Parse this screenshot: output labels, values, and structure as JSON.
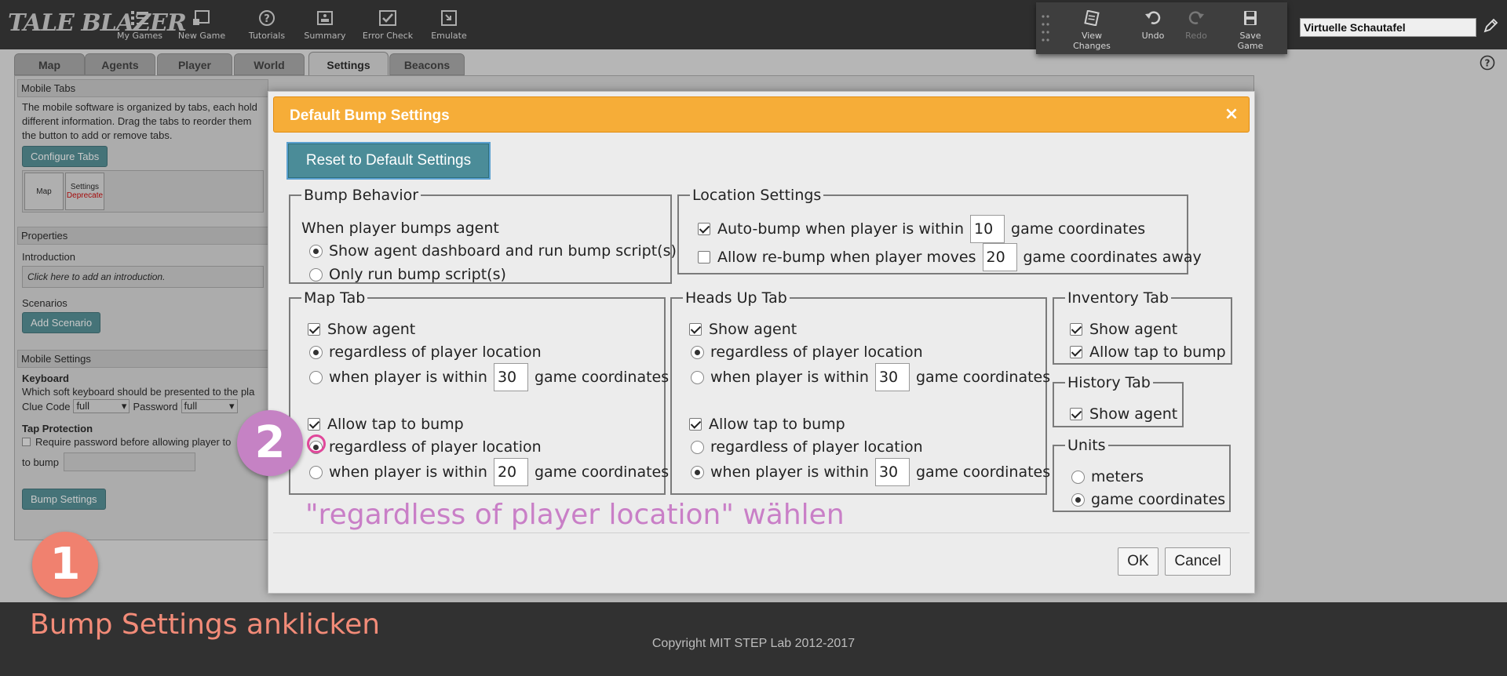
{
  "app": {
    "logo_text": "TALE BLAZER",
    "nav": [
      {
        "label": "My Games",
        "icon": "list-icon"
      },
      {
        "label": "New Game",
        "icon": "new-game-icon"
      },
      {
        "label": "Tutorials",
        "icon": "question-icon"
      },
      {
        "label": "Summary",
        "icon": "summary-icon"
      },
      {
        "label": "Error Check",
        "icon": "check-icon"
      },
      {
        "label": "Emulate",
        "icon": "emulate-icon"
      }
    ],
    "toolbar": {
      "view_changes": "View Changes",
      "undo": "Undo",
      "redo": "Redo",
      "save_game": "Save Game"
    },
    "game_title": "Virtuelle Schautafel"
  },
  "tabs": [
    "Map",
    "Agents",
    "Player",
    "World",
    "Settings",
    "Beacons"
  ],
  "active_tab": "Settings",
  "left_panel": {
    "mobile_tabs_header": "Mobile Tabs",
    "mobile_tabs_desc_1": "The mobile software is organized by tabs, each hold",
    "mobile_tabs_desc_2": "different information. Drag the tabs to reorder them",
    "mobile_tabs_desc_3": "the button to add or remove tabs.",
    "configure_tabs": "Configure Tabs",
    "mini_tab_map": "Map",
    "mini_tab_settings": "Settings",
    "mini_tab_deprecated": "Deprecate",
    "properties_header": "Properties",
    "introduction_label": "Introduction",
    "introduction_placeholder": "Click here to add an introduction.",
    "scenarios_label": "Scenarios",
    "add_scenario": "Add Scenario",
    "mobile_settings_header": "Mobile Settings",
    "keyboard_label": "Keyboard",
    "keyboard_desc": "Which soft keyboard should be presented to the pla",
    "clue_code_label": "Clue Code",
    "clue_code_value": "full",
    "password_label": "Password",
    "password_value": "full",
    "tap_protection_label": "Tap Protection",
    "require_password": "Require password before allowing player to",
    "to_bump": "to bump",
    "bump_settings": "Bump Settings"
  },
  "dialog": {
    "title": "Default Bump Settings",
    "close": "×",
    "reset_button": "Reset to Default Settings",
    "bump_behavior": {
      "legend": "Bump Behavior",
      "intro": "When player bumps agent",
      "opt1": "Show agent dashboard and run bump script(s)",
      "opt2": "Only run bump script(s)"
    },
    "location_settings": {
      "legend": "Location Settings",
      "auto_bump_pre": "Auto-bump when player is within",
      "auto_bump_value": "10",
      "auto_bump_post": "game coordinates",
      "rebump_pre": "Allow re-bump when player moves",
      "rebump_value": "20",
      "rebump_post": "game coordinates away"
    },
    "map_tab": {
      "legend": "Map Tab",
      "show_agent": "Show agent",
      "regardless": "regardless of player location",
      "within_pre": "when player is within",
      "within_value": "30",
      "within_post": "game coordinates",
      "allow_tap": "Allow tap to bump",
      "tap_regardless": "regardless of player location",
      "tap_within_pre": "when player is within",
      "tap_within_value": "20",
      "tap_within_post": "game coordinates"
    },
    "heads_up_tab": {
      "legend": "Heads Up Tab",
      "show_agent": "Show agent",
      "regardless": "regardless of player location",
      "within_pre": "when player is within",
      "within_value": "30",
      "within_post": "game coordinates",
      "allow_tap": "Allow tap to bump",
      "tap_regardless": "regardless of player location",
      "tap_within_pre": "when player is within",
      "tap_within_value": "30",
      "tap_within_post": "game coordinates"
    },
    "inventory_tab": {
      "legend": "Inventory Tab",
      "show_agent": "Show agent",
      "allow_tap": "Allow tap to bump"
    },
    "history_tab": {
      "legend": "History Tab",
      "show_agent": "Show agent"
    },
    "units": {
      "legend": "Units",
      "meters": "meters",
      "game_coordinates": "game coordinates"
    },
    "ok": "OK",
    "cancel": "Cancel"
  },
  "annotations": {
    "step1_number": "1",
    "step1_text": "Bump Settings anklicken",
    "step2_number": "2",
    "step2_text": "\"regardless of player location\" wählen"
  },
  "footer": {
    "copyright": "Copyright MIT STEP Lab 2012-2017"
  },
  "colors": {
    "topbar": "#313131",
    "dialog_header": "#f6ad38",
    "teal_button": "#4b8c98",
    "annotation_1": "#f0816f",
    "annotation_2": "#c582c4"
  }
}
